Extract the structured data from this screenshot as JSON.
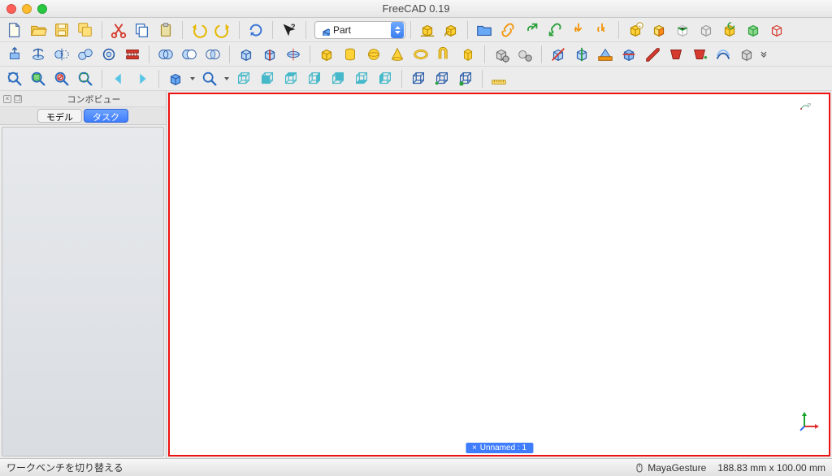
{
  "window": {
    "title": "FreeCAD 0.19"
  },
  "workbench": {
    "label": "Part"
  },
  "sidepanel": {
    "title": "コンボビュー",
    "tabs": {
      "model": "モデル",
      "task": "タスク"
    }
  },
  "canvas": {
    "doc_tab_prefix": "×",
    "doc_tab_label": "Unnamed : 1"
  },
  "status": {
    "message": "ワークベンチを切り替える",
    "nav_style": "MayaGesture",
    "dimensions": "188.83 mm x 100.00 mm"
  },
  "icons": {
    "row1": [
      "new-file-icon",
      "open-file-icon",
      "save-file-icon",
      "save-as-icon",
      "sep",
      "cut-icon",
      "copy-icon",
      "paste-icon",
      "sep",
      "undo-icon",
      "redo-icon",
      "sep",
      "refresh-icon",
      "sep",
      "what-is-this-icon",
      "sep",
      "workbench-select",
      "sep",
      "measure-distance-box-icon",
      "measure-angle-box-icon",
      "sep",
      "group-icon",
      "link-icon",
      "link-external-icon",
      "link-replace-icon",
      "link-import-icon",
      "link-import-all-icon",
      "sep",
      "part-create-icon",
      "part-cube-face-icon",
      "part-highlight-icon",
      "part-ghost-icon",
      "part-cycle-icon",
      "part-green-icon",
      "part-outline-icon"
    ],
    "row2": [
      "extrude-icon",
      "revolve-icon",
      "mirror-icon",
      "fillet-icon",
      "chamfer-icon",
      "ruled-surface-icon",
      "sep",
      "boolean-union-icon",
      "boolean-cut-icon",
      "boolean-intersect-icon",
      "sep",
      "compound-icon",
      "compound-split-icon",
      "slice-icon",
      "sep",
      "box-icon",
      "cylinder-icon",
      "sphere-icon",
      "cone-icon",
      "torus-icon",
      "pipe-icon",
      "prism-icon",
      "sep",
      "builder-gear-icon",
      "shape-gear-icon",
      "sep",
      "section-x-icon",
      "section-z-icon",
      "section-plane-icon",
      "cross-section-icon",
      "offset-3d-icon",
      "loft-red-icon",
      "loft-add-icon",
      "thickness-icon",
      "projection-icon"
    ],
    "row3": [
      "zoom-fit-icon",
      "zoom-select-icon",
      "zoom-nosel-icon",
      "zoom-region-icon",
      "sep",
      "nav-back-icon",
      "nav-forward-icon",
      "sep",
      "iso-view-icon",
      "arrow",
      "zoom-search-icon",
      "arrow",
      "view-iso2-icon",
      "view-front-icon",
      "view-top-icon",
      "view-right-icon",
      "view-rear-icon",
      "view-bottom-icon",
      "view-left-icon",
      "sep",
      "box-wire-1-icon",
      "box-wire-2-icon",
      "box-wire-3-icon",
      "sep",
      "ruler-icon"
    ]
  }
}
